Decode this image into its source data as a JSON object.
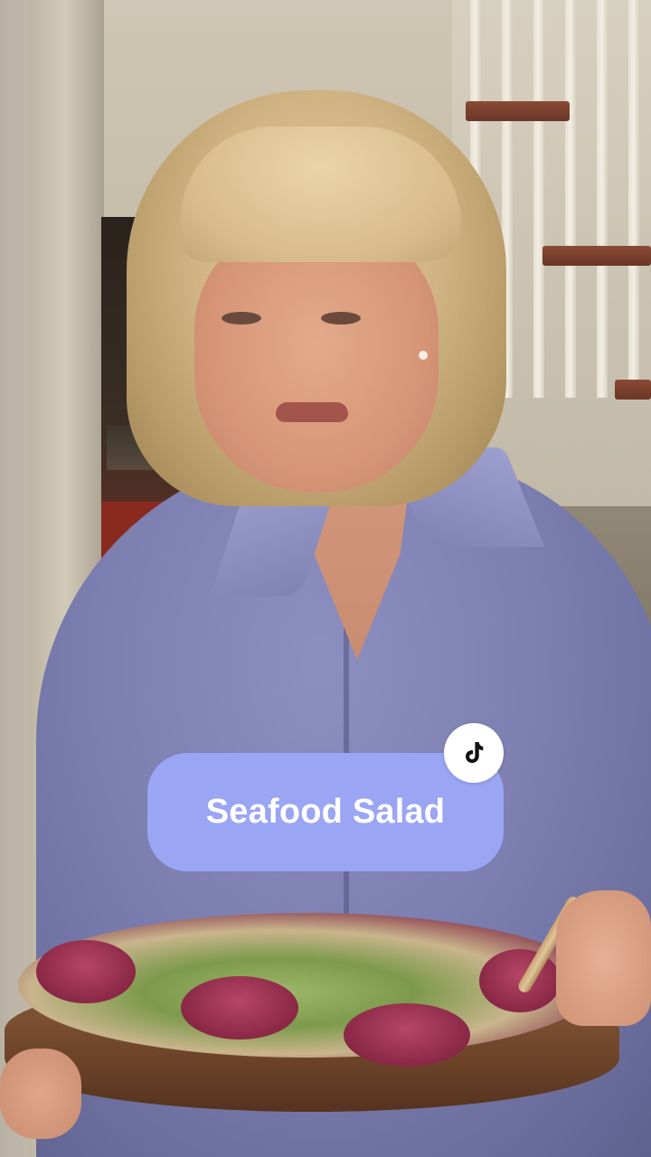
{
  "video": {
    "title_overlay": "Seafood Salad",
    "badge_icon": "tiktok-logo-icon"
  },
  "colors": {
    "title_pill_bg": "#9aa5f4",
    "title_text": "#ffffff",
    "badge_bg": "#ffffff"
  }
}
